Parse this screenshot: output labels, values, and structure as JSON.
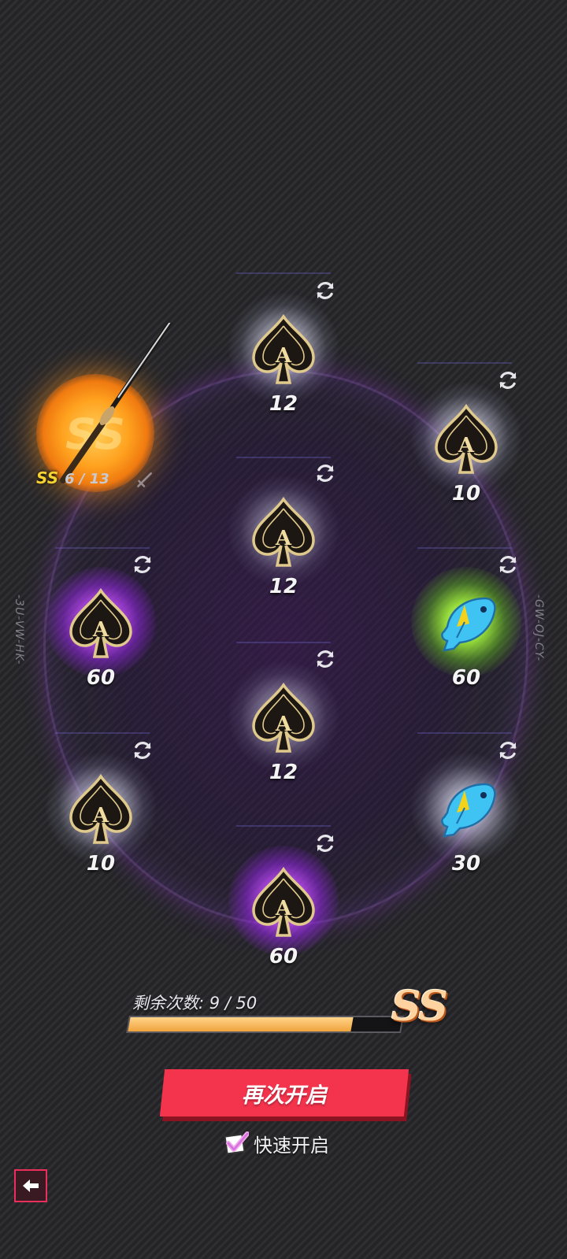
{
  "side_codes": {
    "left": "-3U-VW-HK-",
    "right": "-GW-OJ-CY-"
  },
  "ss_item": {
    "orb_label": "SS",
    "grade_tag": "SS",
    "count": "6 / 13"
  },
  "slots": [
    {
      "id": "top",
      "icon": "spade-ace-icon",
      "glow": "white",
      "qty": "12"
    },
    {
      "id": "upper-right",
      "icon": "spade-ace-icon",
      "glow": "white",
      "qty": "10"
    },
    {
      "id": "center-top",
      "icon": "spade-ace-icon",
      "glow": "white",
      "qty": "12"
    },
    {
      "id": "left",
      "icon": "spade-ace-icon",
      "glow": "purple",
      "qty": "60"
    },
    {
      "id": "right",
      "icon": "fish-icon",
      "glow": "green",
      "qty": "60"
    },
    {
      "id": "center",
      "icon": "spade-ace-icon",
      "glow": "white",
      "qty": "12"
    },
    {
      "id": "lower-left",
      "icon": "spade-ace-icon",
      "glow": "white",
      "qty": "10"
    },
    {
      "id": "lower-right",
      "icon": "fish-icon",
      "glow": "white",
      "qty": "30"
    },
    {
      "id": "bottom",
      "icon": "spade-ace-icon",
      "glow": "purple",
      "qty": "60"
    }
  ],
  "progress": {
    "label": "剩余次数: 9 / 50",
    "remaining": 9,
    "total": 50,
    "grade": "SS"
  },
  "actions": {
    "reopen_label": "再次开启",
    "quick_open_label": "快速开启",
    "quick_open_checked": true
  },
  "colors": {
    "accent_red": "#f4334d",
    "progress_fill": "#f0a33c",
    "grade_tag": "#f5d230"
  }
}
